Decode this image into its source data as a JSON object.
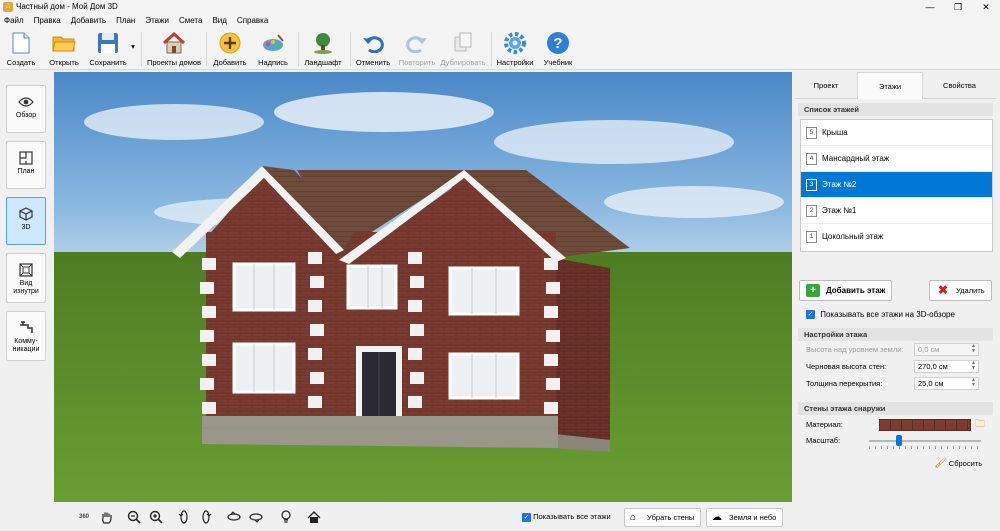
{
  "window": {
    "title": "Частный дом - Мой Дом 3D"
  },
  "menu": [
    "Файл",
    "Правка",
    "Добавить",
    "План",
    "Этажи",
    "Смета",
    "Вид",
    "Справка"
  ],
  "toolbar": {
    "create": "Создать",
    "open": "Открыть",
    "save": "Сохранить",
    "projects": "Проекты домов",
    "add": "Добавить",
    "label": "Надпись",
    "landscape": "Ландшафт",
    "undo": "Отменить",
    "redo": "Повторить",
    "duplicate": "Дублировать",
    "settings": "Настройки",
    "tutorial": "Учебник"
  },
  "left_nav": [
    {
      "label": "Обзор"
    },
    {
      "label": "План"
    },
    {
      "label": "3D"
    },
    {
      "label": "Вид изнутри"
    },
    {
      "label": "Комму-никации"
    }
  ],
  "bottom": {
    "icon_360": "360",
    "show_all_floors": "Показывать все этажи",
    "remove_walls": "Убрать стены",
    "earth_sky": "Земля и небо"
  },
  "panel": {
    "tabs": [
      "Проект",
      "Этажи",
      "Свойства"
    ],
    "active_tab": "Этажи",
    "list_title": "Список этажей",
    "floors": [
      {
        "num": "5",
        "name": "Крыша"
      },
      {
        "num": "4",
        "name": "Мансардный этаж"
      },
      {
        "num": "3",
        "name": "Этаж №2",
        "selected": true
      },
      {
        "num": "2",
        "name": "Этаж №1"
      },
      {
        "num": "1",
        "name": "Цокольный этаж"
      }
    ],
    "add_floor": "Добавить этаж",
    "delete": "Удалить",
    "show_all_3d": "Показывать все этажи на 3D-обзоре",
    "settings_title": "Настройки этажа",
    "height_label": "Высота над уровнем земли:",
    "height_value": "0,0 см",
    "rough_height_label": "Черновая высота стен:",
    "rough_height_value": "270,0 см",
    "slab_label": "Толщина перекрытия:",
    "slab_value": "25,0 см",
    "walls_title": "Стены этажа снаружи",
    "material_label": "Материал:",
    "scale_label": "Масштаб:",
    "reset": "Сбросить"
  },
  "colors": {
    "accent": "#0078d7",
    "brick": "#7a3a31",
    "grass": "#5d8f2a",
    "roof": "#6b4a3c"
  }
}
